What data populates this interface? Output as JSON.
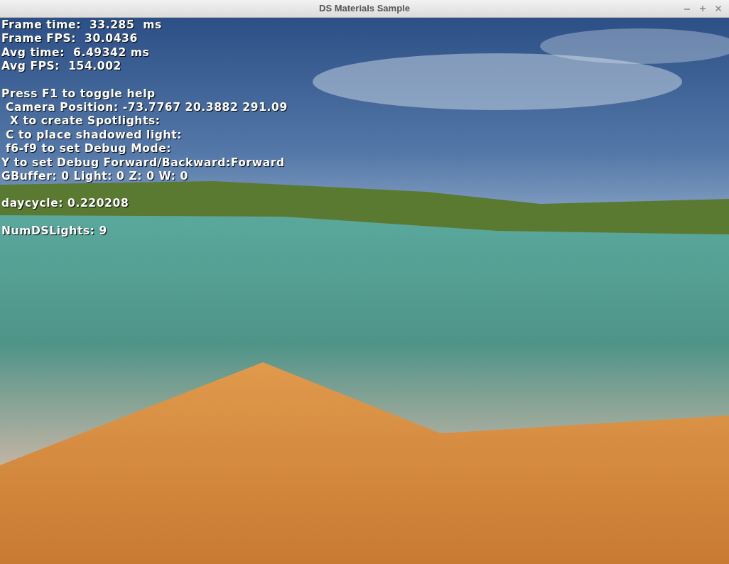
{
  "window": {
    "title": "DS Materials Sample"
  },
  "overlay_groups": [
    [
      "Frame time:  33.285  ms",
      "Frame FPS:  30.0436",
      "Avg time:  6.49342 ms",
      "Avg FPS:  154.002"
    ],
    [
      "Press F1 to toggle help",
      " Camera Position: -73.7767 20.3882 291.09",
      "  X to create Spotlights:",
      " C to place shadowed light:",
      " f6-f9 to set Debug Mode:",
      "Y to set Debug Forward/Backward:Forward",
      "GBuffer: 0 Light: 0 Z: 0 W: 0"
    ],
    [
      "daycycle: 0.220208"
    ],
    [
      "NumDSLights: 9"
    ]
  ]
}
